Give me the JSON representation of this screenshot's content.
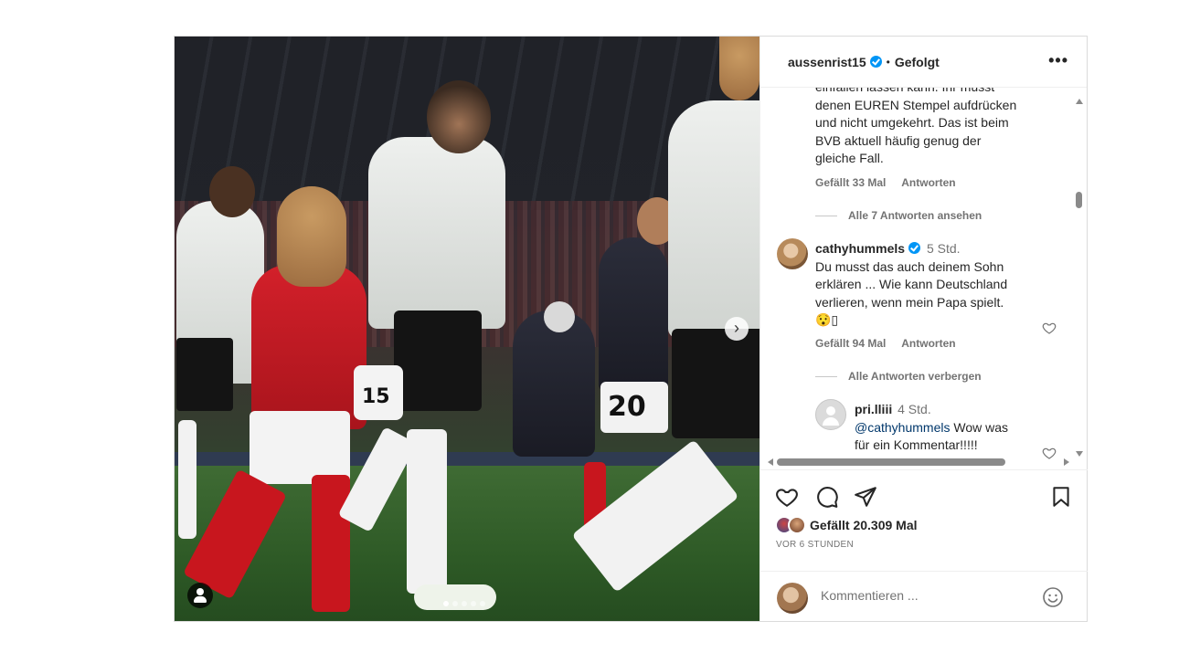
{
  "post": {
    "username": "aussenrist15",
    "separator": "•",
    "follow_status": "Gefolgt",
    "more_icon": "more-horizontal-icon"
  },
  "comments": {
    "partial": {
      "lines": [
        "einfallen lassen kann. Ihr müsst",
        "denen EUREN Stempel aufdrücken",
        "und nicht umgekehrt. Das ist beim",
        "BVB aktuell häufig genug der",
        "gleiche Fall."
      ],
      "likes": "Gefällt 33 Mal",
      "reply": "Antworten",
      "view_replies": "Alle 7 Antworten ansehen"
    },
    "cathy": {
      "username": "cathyhummels",
      "time": "5 Std.",
      "lines": [
        "Du musst das auch deinem Sohn",
        "erklären ... Wie kann Deutschland",
        "verlieren, wenn mein Papa spielt.",
        "😯▯"
      ],
      "likes": "Gefällt 94 Mal",
      "reply": "Antworten",
      "hide_replies": "Alle Antworten verbergen"
    },
    "pri": {
      "username": "pri.lliii",
      "time": "4 Std.",
      "mention": "@cathyhummels",
      "text_1": " Wow was",
      "text_2": "für ein Kommentar!!!!!"
    }
  },
  "actions": {
    "likes": "Gefällt 20.309 Mal",
    "time_ago": "VOR 6 STUNDEN",
    "comment_placeholder": "Kommentieren ..."
  },
  "colors": {
    "verified": "#0095f6",
    "mention": "#00376b",
    "secondary_text": "#737373"
  },
  "photo": {
    "jersey_numbers": [
      "15",
      "20"
    ]
  }
}
